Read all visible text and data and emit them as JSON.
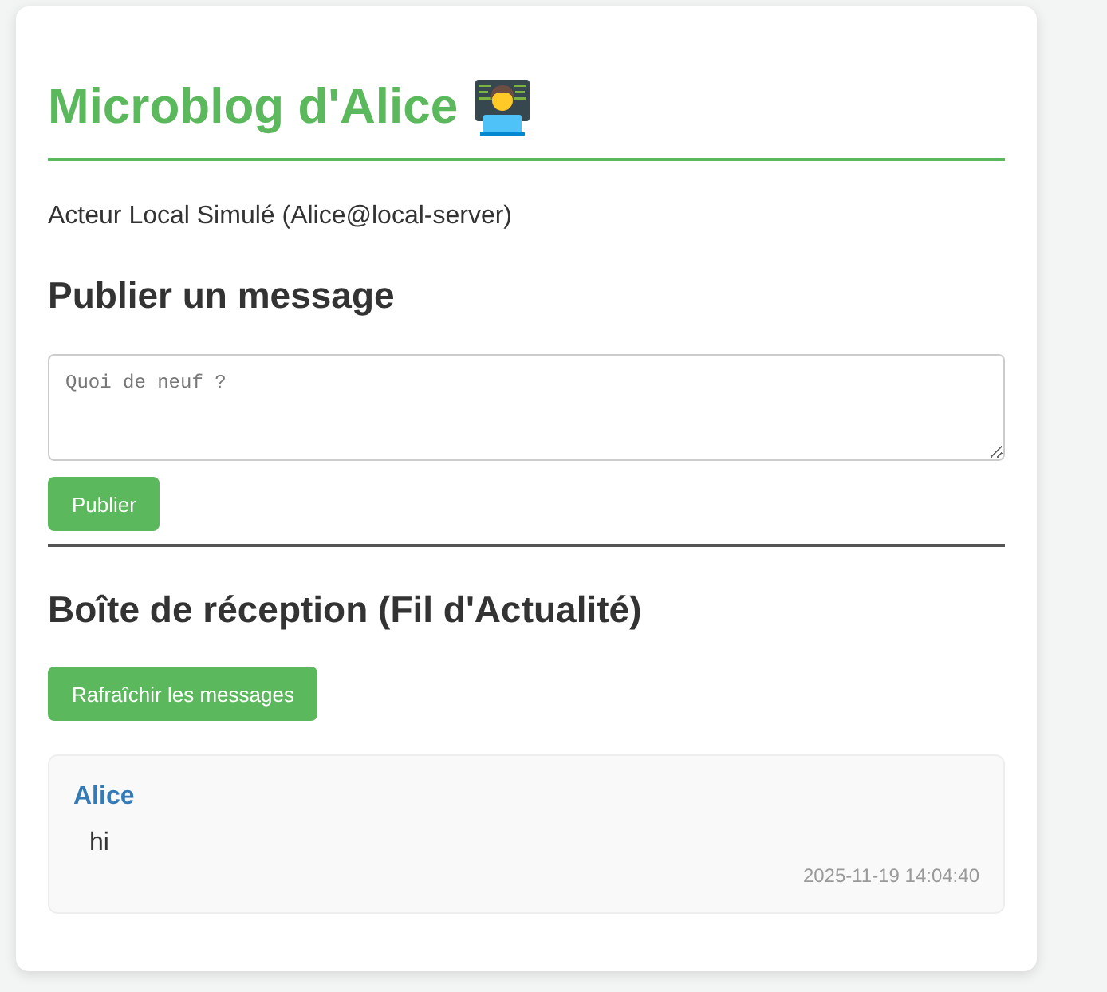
{
  "header": {
    "title": "Microblog d'Alice"
  },
  "actor": "Acteur Local Simulé (Alice@local-server)",
  "publish": {
    "heading": "Publier un message",
    "message_field": {
      "placeholder": "Quoi de neuf ?"
    },
    "button": "Publier"
  },
  "inbox": {
    "heading": "Boîte de réception (Fil d'Actualité)",
    "refresh_button": "Rafraîchir les messages",
    "messages": [
      {
        "author": "Alice",
        "text": "hi",
        "timestamp": "2025-11-19 14:04:40"
      }
    ]
  }
}
